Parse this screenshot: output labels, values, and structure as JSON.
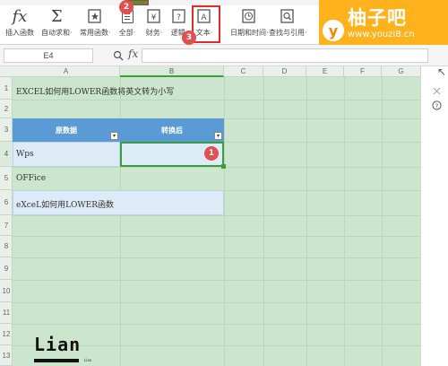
{
  "ribbon": {
    "buttons": [
      {
        "label": "插入函数",
        "icon": "fx-icon"
      },
      {
        "label": "自动求和·",
        "icon": "sigma-icon"
      },
      {
        "label": "常用函数·",
        "icon": "star-function-icon"
      },
      {
        "label": "全部·",
        "icon": "all-functions-icon"
      },
      {
        "label": "财务·",
        "icon": "finance-icon"
      },
      {
        "label": "逻辑·",
        "icon": "logic-icon"
      },
      {
        "label": "文本·",
        "icon": "text-function-icon"
      },
      {
        "label": "日期和时间·",
        "icon": "date-time-icon"
      },
      {
        "label": "查找与引用·",
        "icon": "lookup-icon"
      }
    ],
    "badges": {
      "b2": "2",
      "b3": "3"
    }
  },
  "watermark": {
    "logo_letter": "y",
    "title": "柚子吧",
    "url": "www.youzi8.cn"
  },
  "formula_bar": {
    "cell_ref": "E4",
    "fx_label": "fx",
    "value": ""
  },
  "columns": [
    "A",
    "B",
    "C",
    "D",
    "E",
    "F",
    "G"
  ],
  "rows": [
    "1",
    "2",
    "3",
    "4",
    "5",
    "6",
    "7",
    "8",
    "9",
    "10",
    "11",
    "12",
    "13"
  ],
  "sheet": {
    "title": "EXCEL如何用LOWER函数将英文转为小写",
    "table_headers": [
      "原数据",
      "转换后"
    ],
    "data": [
      "Wps",
      "OFFice",
      "eXceL如何用LOWER函数"
    ],
    "badge1": "1"
  },
  "signature": {
    "text": "Lian",
    "small": "Lian"
  },
  "colors": {
    "accent": "#3e9b3e",
    "table_header": "#5b9bd5",
    "sheet_bg": "#cbe6cc",
    "highlight": "#e02b2b",
    "badge": "#e05050",
    "watermark": "#ffb21c"
  }
}
